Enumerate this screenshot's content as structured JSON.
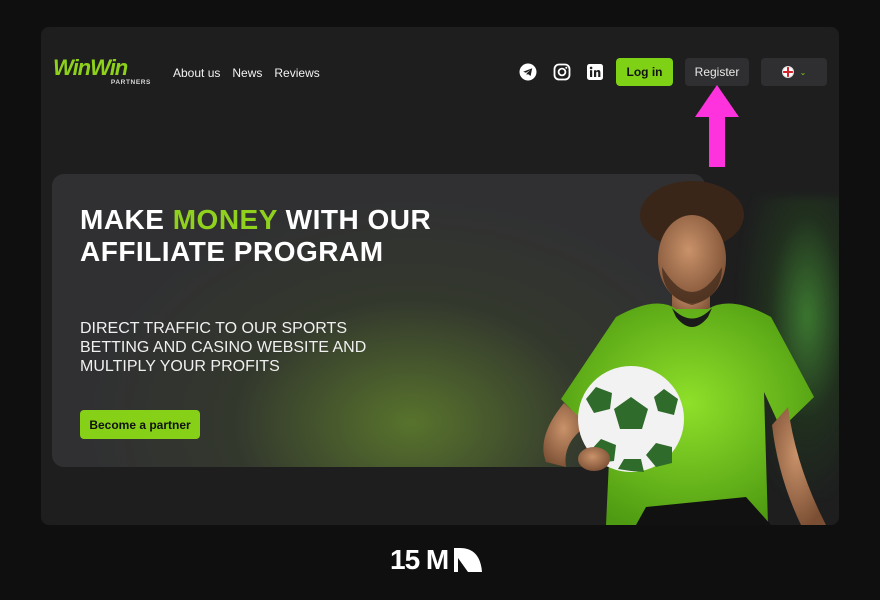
{
  "header": {
    "logo_main": "WinWin",
    "logo_sub": "PARTNERS",
    "nav": [
      "About us",
      "News",
      "Reviews"
    ],
    "social_icons": [
      "telegram-icon",
      "instagram-icon",
      "linkedin-icon"
    ],
    "login_label": "Log in",
    "register_label": "Register",
    "language_icon": "uk-flag-icon"
  },
  "hero": {
    "title_part1": "MAKE ",
    "title_accent": "MONEY",
    "title_part2": " WITH OUR AFFILIATE PROGRAM",
    "subtitle": "DIRECT TRAFFIC TO OUR SPORTS BETTING AND CASINO WEBSITE AND MULTIPLY YOUR PROFITS",
    "cta_label": "Become a partner"
  },
  "footer": {
    "brand": "15 M"
  },
  "colors": {
    "accent": "#86d117",
    "background": "#1e1e1f",
    "annotation_arrow": "#ff33dd"
  }
}
